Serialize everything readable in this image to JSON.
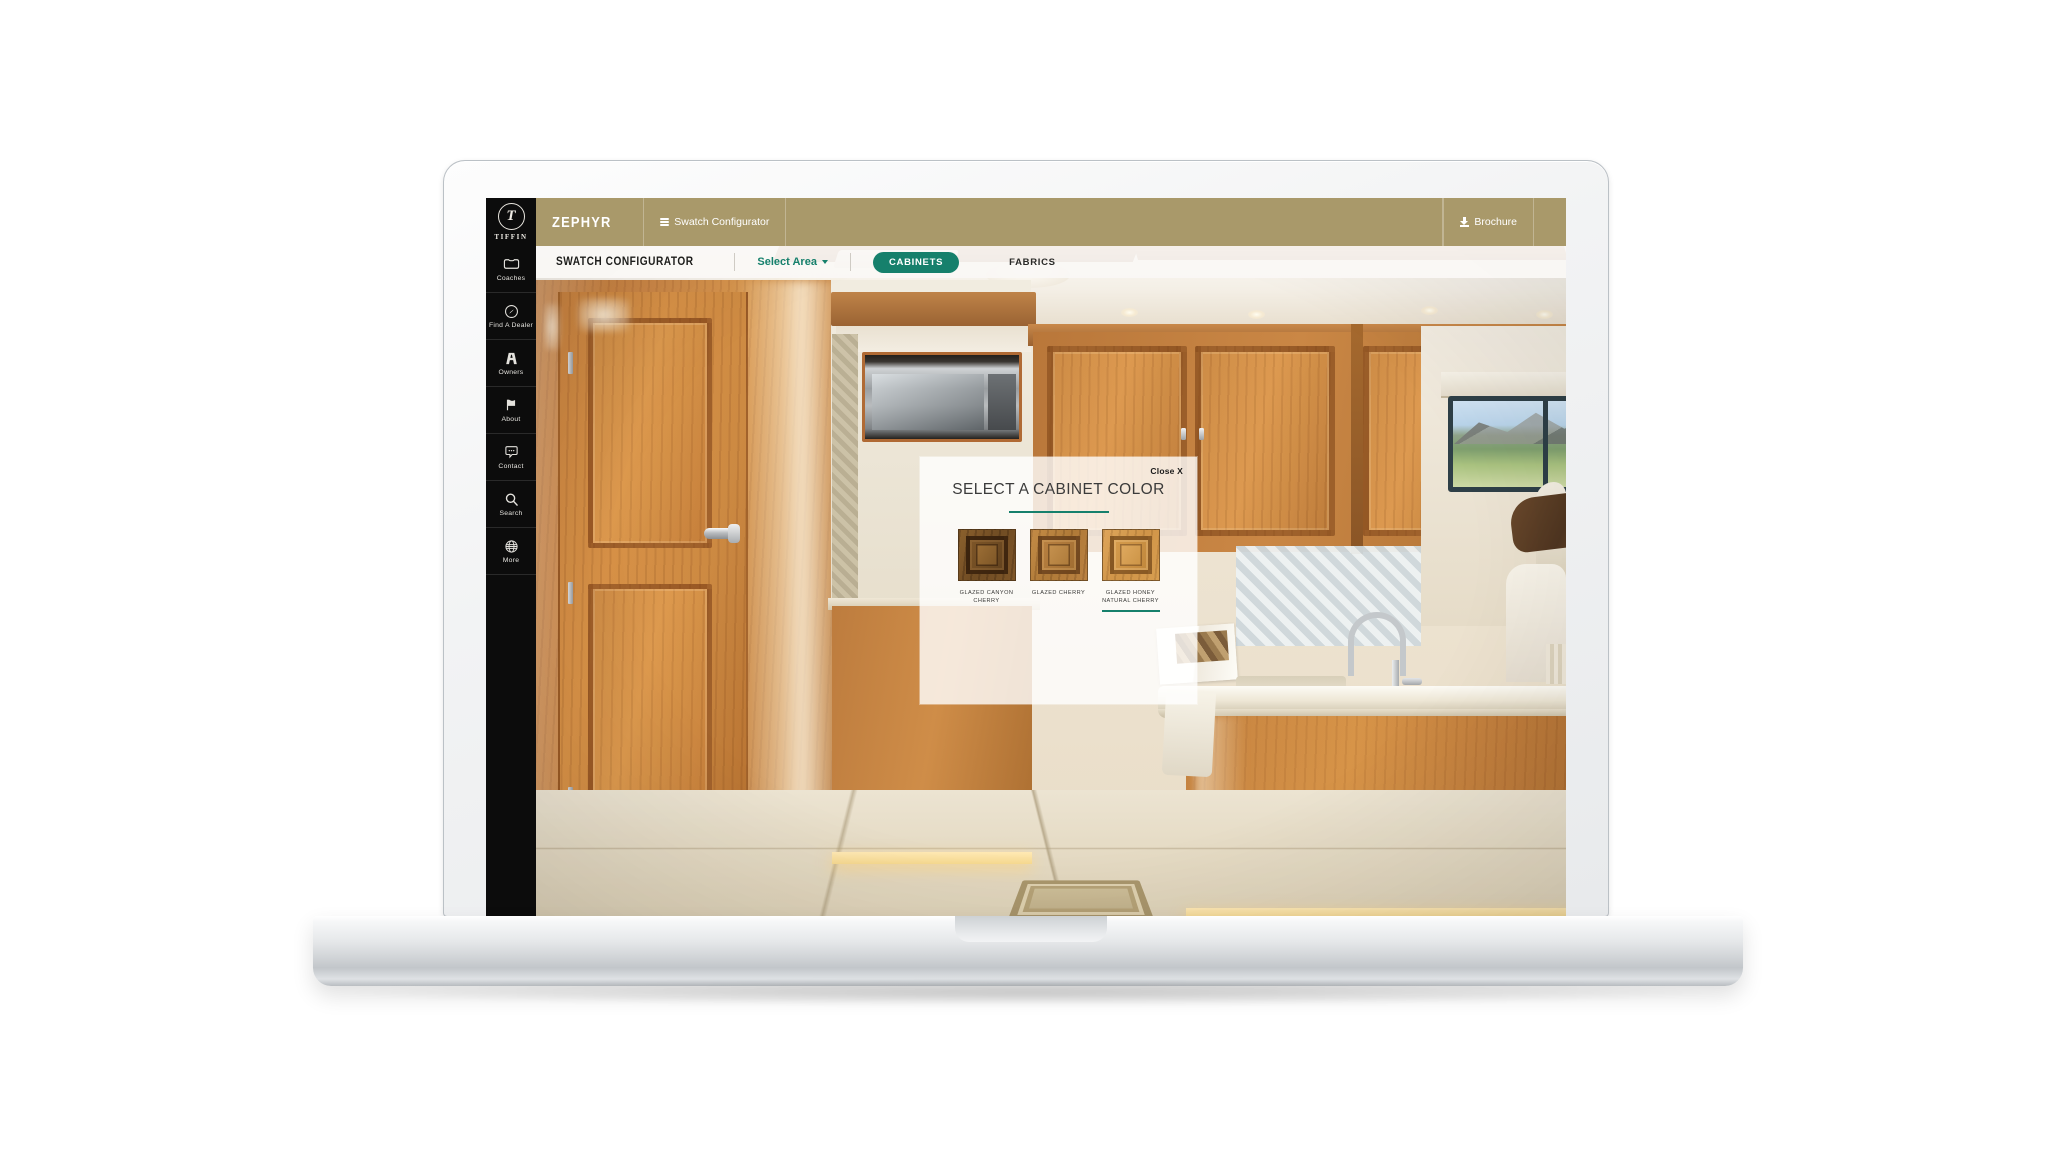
{
  "site": {
    "brand": {
      "logo_mark": "tiffin-emblem",
      "logo_text": "TIFFIN"
    },
    "top_bar": {
      "model_name": "ZEPHYR",
      "configurator_menu_label": "Swatch Configurator",
      "brochure_label": "Brochure",
      "background_color": "#a9996a"
    },
    "sidebar": {
      "items": [
        {
          "label": "Coaches",
          "icon": "coach-icon"
        },
        {
          "label": "Find A Dealer",
          "icon": "compass-icon"
        },
        {
          "label": "Owners",
          "icon": "road-icon"
        },
        {
          "label": "About",
          "icon": "flag-icon"
        },
        {
          "label": "Contact",
          "icon": "chat-bubble-icon"
        },
        {
          "label": "Search",
          "icon": "search-icon"
        },
        {
          "label": "More",
          "icon": "globe-icon"
        }
      ]
    },
    "toolbar": {
      "title": "SWATCH CONFIGURATOR",
      "select_area_label": "Select Area",
      "tabs": [
        {
          "label": "CABINETS",
          "active": true
        },
        {
          "label": "FABRICS",
          "active": false
        }
      ],
      "accent_color": "#16806c"
    },
    "modal": {
      "title": "SELECT A CABINET COLOR",
      "close_label": "Close X",
      "swatches": [
        {
          "name": "GLAZED CANYON CHERRY",
          "selected": false,
          "color": "#6d4a22"
        },
        {
          "name": "GLAZED CHERRY",
          "selected": false,
          "color": "#b07c3c"
        },
        {
          "name": "GLAZED HONEY NATURAL CHERRY",
          "selected": true,
          "color": "#cd9245"
        }
      ]
    },
    "scene": {
      "description": "Tiffin Zephyr motorhome interior galley with glazed cherry cabinetry, door, kitchen island with sink, window view of mountains and cream sofa"
    }
  }
}
